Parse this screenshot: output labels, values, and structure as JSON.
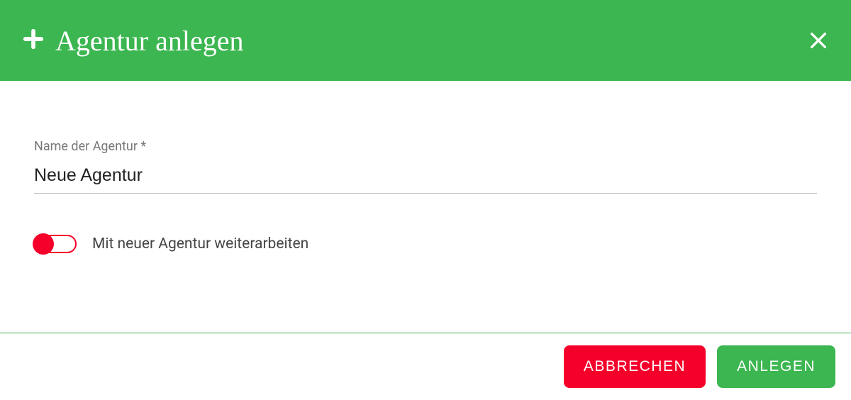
{
  "header": {
    "title": "Agentur anlegen"
  },
  "form": {
    "name_label": "Name der Agentur *",
    "name_value": "Neue Agentur",
    "toggle_label": "Mit neuer Agentur weiterarbeiten",
    "toggle_on": false
  },
  "footer": {
    "cancel_label": "ABBRECHEN",
    "submit_label": "ANLEGEN"
  }
}
